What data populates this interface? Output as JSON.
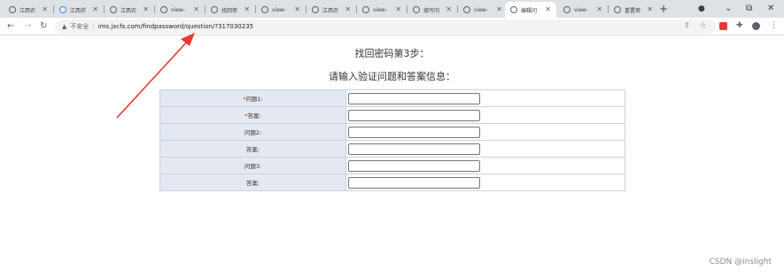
{
  "tabs": [
    {
      "label": "江西农",
      "icon": "globe-icon"
    },
    {
      "label": "江西农",
      "icon": "app-icon"
    },
    {
      "label": "江西农",
      "icon": "globe-icon"
    },
    {
      "label": "view-",
      "icon": "globe-icon"
    },
    {
      "label": "找回密",
      "icon": "globe-icon"
    },
    {
      "label": "view-",
      "icon": "globe-icon"
    },
    {
      "label": "江西农",
      "icon": "globe-icon"
    },
    {
      "label": "view-",
      "icon": "globe-icon"
    },
    {
      "label": "填写问",
      "icon": "globe-icon"
    },
    {
      "label": "view-",
      "icon": "globe-icon"
    },
    {
      "label": "编辑问",
      "icon": "globe-icon",
      "active": true
    },
    {
      "label": "view-",
      "icon": "globe-icon"
    },
    {
      "label": "重置密",
      "icon": "globe-icon"
    }
  ],
  "browser": {
    "new_tab": "+",
    "back": "←",
    "forward": "→",
    "reload": "↻",
    "warn_icon": "▲",
    "insecure_label": "不安全",
    "separator": "|",
    "url": "ims.jxcfs.com/findpassword/question/?317030235",
    "minimize": "⌄",
    "window_restore": "⧉",
    "close": "✕"
  },
  "page": {
    "step_title": "找回密码第3步：",
    "subtitle": "请输入验证问题和答案信息："
  },
  "form": {
    "required_mark": "*",
    "rows": [
      {
        "label": "问题1:",
        "required": true,
        "value": ""
      },
      {
        "label": "答案:",
        "required": true,
        "value": ""
      },
      {
        "label": "问题2:",
        "required": false,
        "value": ""
      },
      {
        "label": "答案:",
        "required": false,
        "value": ""
      },
      {
        "label": "问题3:",
        "required": false,
        "value": ""
      },
      {
        "label": "答案:",
        "required": false,
        "value": ""
      }
    ]
  },
  "watermark": "CSDN @inslight",
  "colors": {
    "annotation_arrow": "#e53935",
    "label_cell_bg": "#e4e9f1",
    "table_border": "#c5d3e6"
  }
}
